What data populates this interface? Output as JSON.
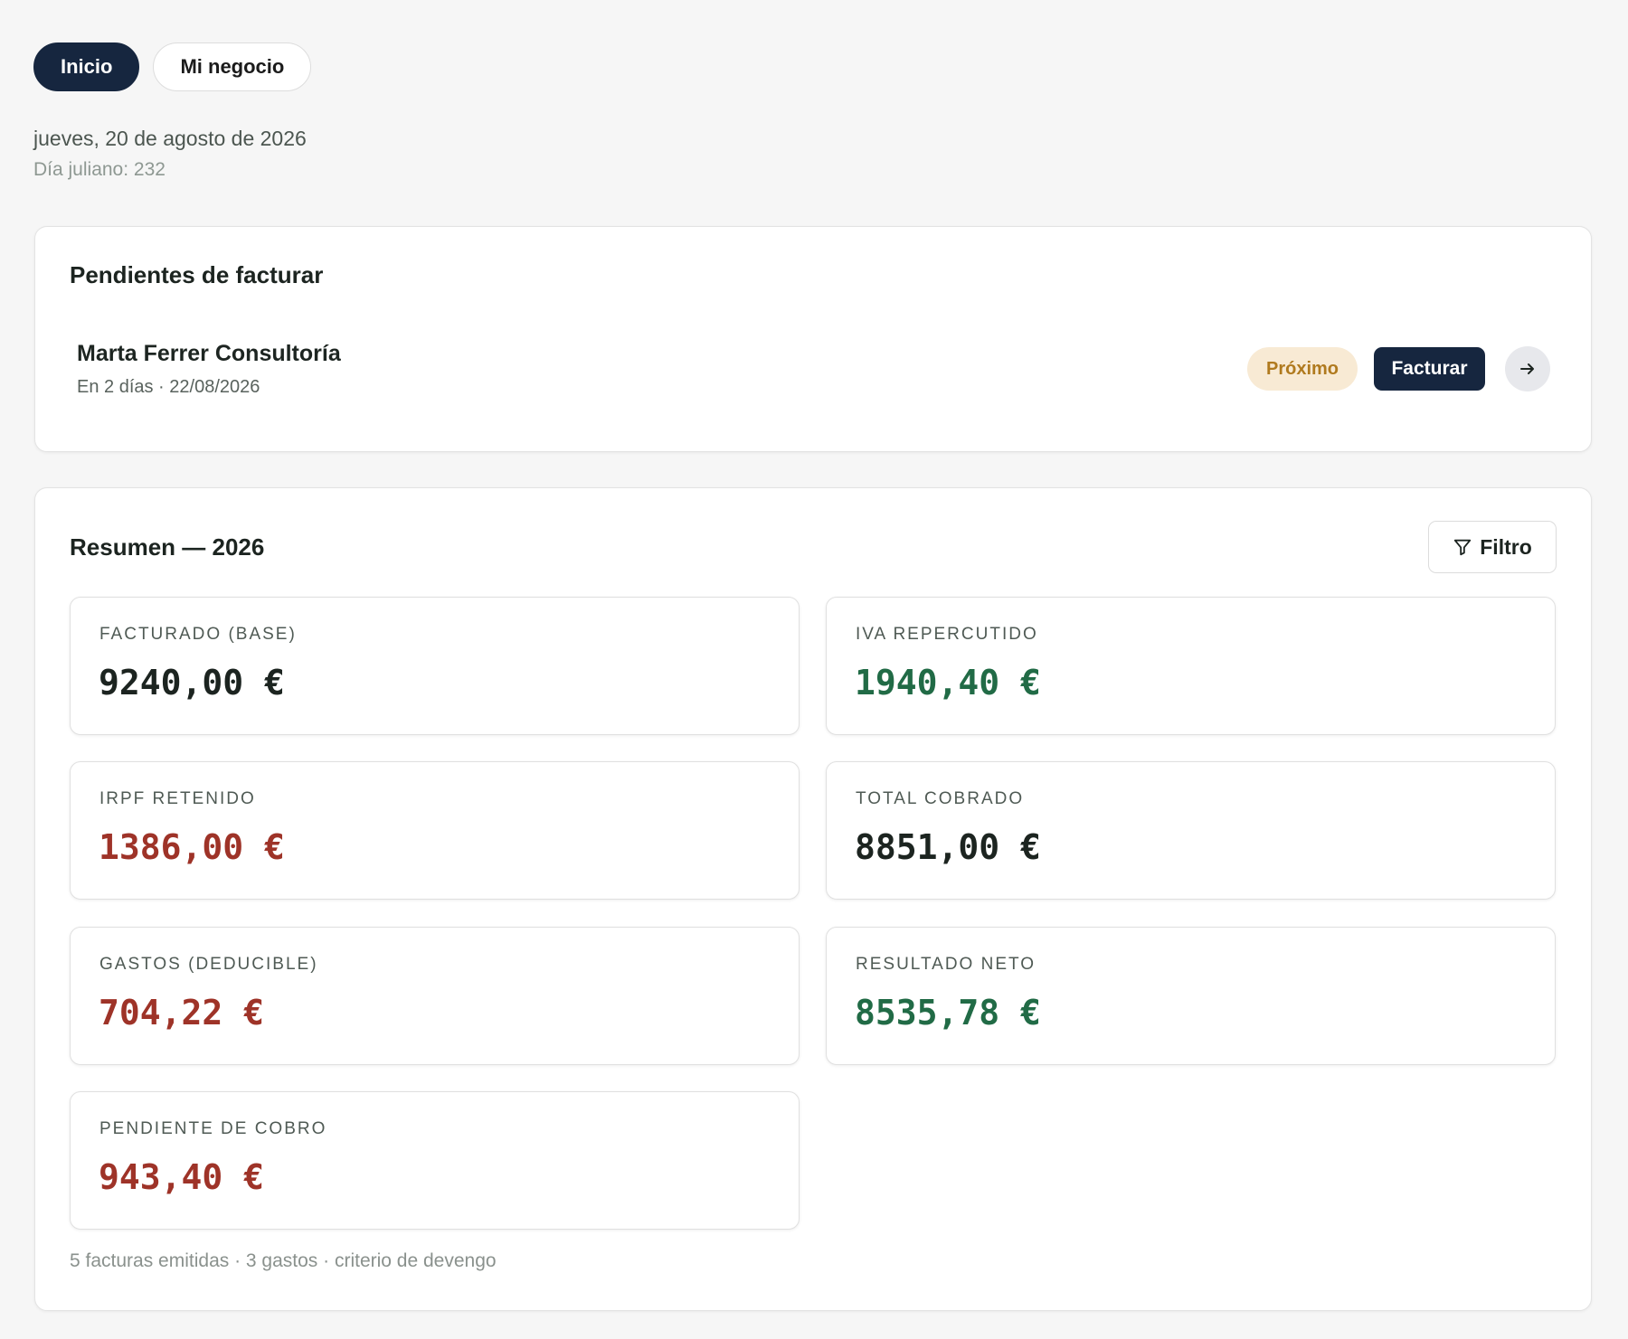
{
  "nav": {
    "tabs": [
      {
        "label": "Inicio",
        "active": true
      },
      {
        "label": "Mi negocio",
        "active": false
      }
    ]
  },
  "header": {
    "date": "jueves, 20 de agosto de 2026",
    "julian": "Día juliano: 232"
  },
  "pending": {
    "title": "Pendientes de facturar",
    "items": [
      {
        "name": "Marta Ferrer Consultoría",
        "subtitle": "En 2 días · 22/08/2026",
        "badge": "Próximo",
        "action_label": "Facturar",
        "open_icon": "arrow-right-icon"
      }
    ]
  },
  "summary": {
    "title": "Resumen — 2026",
    "filter_label": "Filtro",
    "filter_icon": "funnel-icon",
    "stats": [
      {
        "label": "FACTURADO (BASE)",
        "value": "9240,00 €",
        "tone": "neutral"
      },
      {
        "label": "IVA REPERCUTIDO",
        "value": "1940,40 €",
        "tone": "positive"
      },
      {
        "label": "IRPF RETENIDO",
        "value": "1386,00 €",
        "tone": "negative"
      },
      {
        "label": "TOTAL COBRADO",
        "value": "8851,00 €",
        "tone": "neutral"
      },
      {
        "label": "GASTOS (DEDUCIBLE)",
        "value": "704,22 €",
        "tone": "negative"
      },
      {
        "label": "RESULTADO NETO",
        "value": "8535,78 €",
        "tone": "positive"
      },
      {
        "label": "PENDIENTE DE COBRO",
        "value": "943,40 €",
        "tone": "negative"
      }
    ],
    "footer": "5 facturas emitidas · 3 gastos · criterio de devengo"
  },
  "colors": {
    "primary": "#16263f",
    "positive": "#216b46",
    "negative": "#9e3328",
    "badge_bg": "#f8ead4",
    "badge_text": "#b07a1e",
    "background": "#f6f6f6"
  }
}
